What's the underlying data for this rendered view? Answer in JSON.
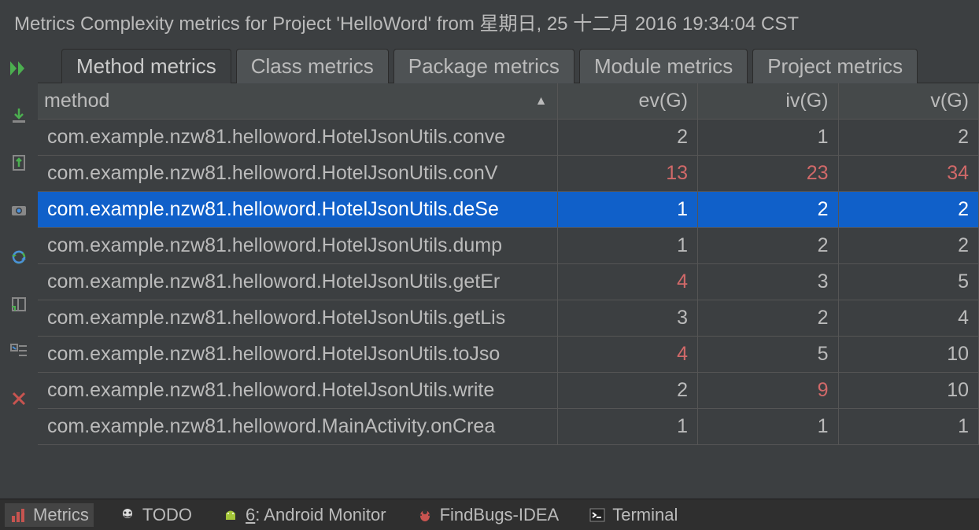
{
  "header": {
    "title": "Metrics Complexity metrics for Project 'HelloWord' from 星期日, 25 十二月 2016 19:34:04 CST"
  },
  "tabs": [
    {
      "label": "Method metrics",
      "active": true
    },
    {
      "label": "Class metrics",
      "active": false
    },
    {
      "label": "Package metrics",
      "active": false
    },
    {
      "label": "Module metrics",
      "active": false
    },
    {
      "label": "Project metrics",
      "active": false
    }
  ],
  "columns": {
    "method": "method",
    "evg": "ev(G)",
    "ivg": "iv(G)",
    "vg": "v(G)",
    "sort_glyph": "▲"
  },
  "threshold": {
    "evg": 4,
    "ivg": 9,
    "vg": 34
  },
  "rows": [
    {
      "method": "com.example.nzw81.helloword.HotelJsonUtils.conve",
      "evg": 2,
      "ivg": 1,
      "vg": 2,
      "selected": false
    },
    {
      "method": "com.example.nzw81.helloword.HotelJsonUtils.conV",
      "evg": 13,
      "ivg": 23,
      "vg": 34,
      "selected": false,
      "evg_red": true,
      "ivg_red": true,
      "vg_red": true
    },
    {
      "method": "com.example.nzw81.helloword.HotelJsonUtils.deSe",
      "evg": 1,
      "ivg": 2,
      "vg": 2,
      "selected": true
    },
    {
      "method": "com.example.nzw81.helloword.HotelJsonUtils.dump",
      "evg": 1,
      "ivg": 2,
      "vg": 2,
      "selected": false
    },
    {
      "method": "com.example.nzw81.helloword.HotelJsonUtils.getEr",
      "evg": 4,
      "ivg": 3,
      "vg": 5,
      "selected": false,
      "evg_red": true
    },
    {
      "method": "com.example.nzw81.helloword.HotelJsonUtils.getLis",
      "evg": 3,
      "ivg": 2,
      "vg": 4,
      "selected": false
    },
    {
      "method": "com.example.nzw81.helloword.HotelJsonUtils.toJso",
      "evg": 4,
      "ivg": 5,
      "vg": 10,
      "selected": false,
      "evg_red": true
    },
    {
      "method": "com.example.nzw81.helloword.HotelJsonUtils.write",
      "evg": 2,
      "ivg": 9,
      "vg": 10,
      "selected": false,
      "ivg_red": true
    },
    {
      "method": "com.example.nzw81.helloword.MainActivity.onCrea",
      "evg": 1,
      "ivg": 1,
      "vg": 1,
      "selected": false
    }
  ],
  "toolbar_icons": [
    "run-icon",
    "import-icon",
    "export-icon",
    "snapshot-icon",
    "refresh-icon",
    "log-icon",
    "settings-icon",
    "close-icon"
  ],
  "bottom": {
    "items": [
      {
        "id": "metrics",
        "label": "Metrics",
        "active": true,
        "icon": "bar-chart-icon"
      },
      {
        "id": "todo",
        "label": "TODO",
        "icon": "todo-icon"
      },
      {
        "id": "android",
        "label_prefix": "6",
        "label_rest": ": Android Monitor",
        "icon": "android-icon"
      },
      {
        "id": "findbugs",
        "label": "FindBugs-IDEA",
        "icon": "bug-icon"
      },
      {
        "id": "terminal",
        "label": "Terminal",
        "icon": "terminal-icon"
      }
    ]
  }
}
